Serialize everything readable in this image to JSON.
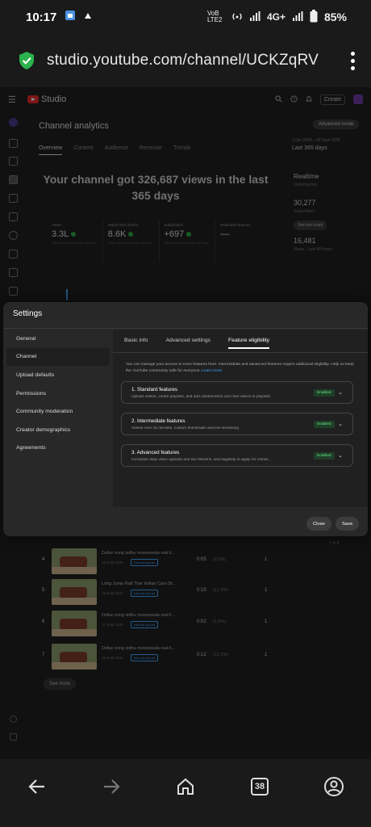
{
  "status_bar": {
    "time": "10:17",
    "network": "VoB LTE2",
    "signal_type": "4G+",
    "battery": "85%"
  },
  "browser": {
    "url": "studio.youtube.com/channel/UCKZqRV",
    "tab_count": "38"
  },
  "studio": {
    "logo_text": "Studio",
    "create_label": "Create",
    "page_title": "Channel analytics",
    "advanced_mode_label": "Advanced mode",
    "analytics_tabs": [
      "Overview",
      "Content",
      "Audience",
      "Revenue",
      "Trends"
    ],
    "date_range_sub": "1 Oct 2024 – 30 Sept 2025",
    "date_range": "Last 365 days",
    "headline": "Your channel got 326,687 views in the last 365 days",
    "stats": [
      {
        "label": "Views",
        "value": "3.3L",
        "sub": "≈55% more than previous 365 days"
      },
      {
        "label": "Watch time (hours)",
        "value": "8.6K",
        "sub": "≈49% more than previous 365 days"
      },
      {
        "label": "Subscribers",
        "value": "+697",
        "sub": "≈30% more than previous 365 days"
      },
      {
        "label": "Estimated revenue",
        "value": "—",
        "sub": ""
      }
    ],
    "realtime": {
      "title": "Realtime",
      "updating": "Updating live",
      "subscribers_value": "30,277",
      "subscribers_label": "Subscribers",
      "see_live_label": "See live count",
      "views_value": "16,481",
      "views_label": "Views · Last 48 hours"
    },
    "videos": [
      {
        "rank": "4",
        "title": "Dollar song sidhu moosewala real li...",
        "date": "15 Sept 2025",
        "tag": "Normal upload",
        "avg": "0:05",
        "pct": "(2.2%)",
        "views": "1"
      },
      {
        "rank": "5",
        "title": "Long Jump Rail Thar Indian Cars Dr...",
        "date": "18 Sept 2025",
        "tag": "Normal upload",
        "avg": "0:15",
        "pct": "(12.3%)",
        "views": "1"
      },
      {
        "rank": "6",
        "title": "Dollar song sidhu moosewala real li...",
        "date": "17 Sept 2025",
        "tag": "Normal upload",
        "avg": "0:02",
        "pct": "(1.5%)",
        "views": "1"
      },
      {
        "rank": "7",
        "title": "Dollar song sidhu moosewala real li...",
        "date": "16 Sept 2025",
        "tag": "Normal upload",
        "avg": "0:12",
        "pct": "(12.2%)",
        "views": "1"
      }
    ],
    "page_info": "1 of 8",
    "see_more_label": "See more"
  },
  "settings": {
    "title": "Settings",
    "nav": [
      "General",
      "Channel",
      "Upload defaults",
      "Permissions",
      "Community moderation",
      "Creator demographics",
      "Agreements"
    ],
    "active_nav_index": 1,
    "tabs": [
      "Basic info",
      "Advanced settings",
      "Feature eligibility"
    ],
    "active_tab_index": 2,
    "description": "You can manage your access to more features here. Intermediate and advanced features require additional eligibility. Help us keep the YouTube community safe for everyone.",
    "learn_more": "Learn more",
    "features": [
      {
        "title": "1. Standard features",
        "desc": "Upload videos, create playlists, and add collaborators and new videos to playlists",
        "status": "Enabled"
      },
      {
        "title": "2. Intermediate features",
        "desc": "Videos over 15 minutes, custom thumbnails and live streaming",
        "status": "Enabled"
      },
      {
        "title": "3. Advanced features",
        "desc": "Increases daily video uploads and live streams, and eligibility to apply for monet...",
        "status": "Enabled"
      }
    ],
    "close_label": "Close",
    "save_label": "Save"
  }
}
